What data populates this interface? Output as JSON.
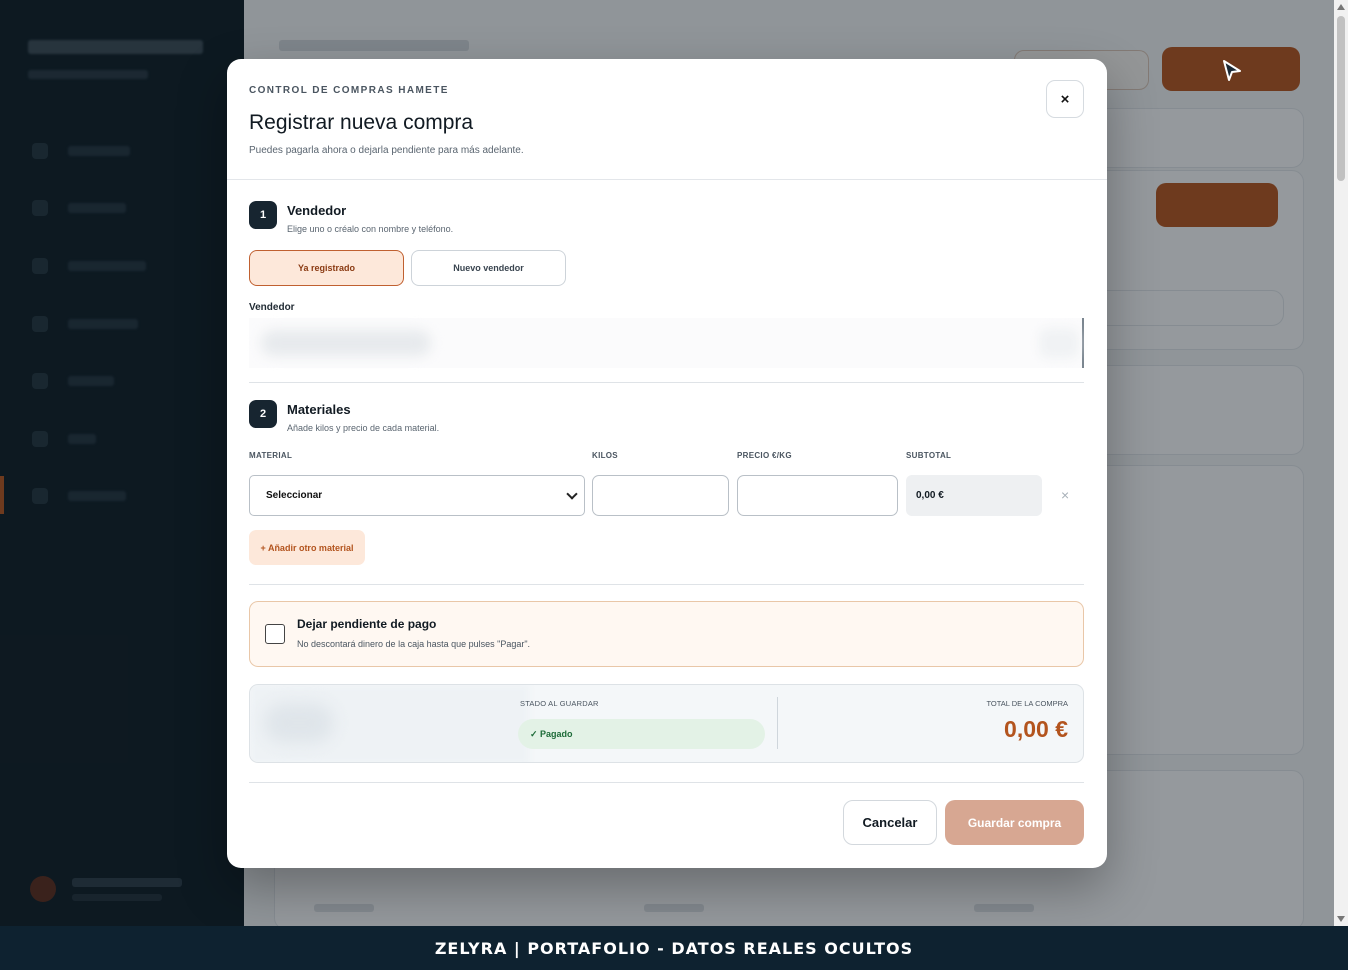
{
  "modal": {
    "eyebrow": "CONTROL DE COMPRAS HAMETE",
    "title": "Registrar nueva compra",
    "description": "Puedes pagarla ahora o dejarla pendiente para más adelante.",
    "close_label": "×"
  },
  "vendor_step": {
    "number": "1",
    "title": "Vendedor",
    "subtitle": "Elige uno o créalo con nombre y teléfono.",
    "option_registered": "Ya registrado",
    "option_new": "Nuevo vendedor",
    "selected_option": "Ya registrado",
    "field_label": "Vendedor"
  },
  "materials_step": {
    "number": "2",
    "title": "Materiales",
    "subtitle": "Añade kilos y precio de cada material.",
    "columns": {
      "material": "MATERIAL",
      "kilos": "KILOS",
      "price": "PRECIO €/KG",
      "subtotal": "SUBTOTAL"
    },
    "row": {
      "material_value": "Seleccionar",
      "kilos_value": "",
      "price_value": "",
      "subtotal_value": "0,00 €",
      "remove_label": "×"
    },
    "add_label": "+ Añadir otro material"
  },
  "pending": {
    "checked": false,
    "title": "Dejar pendiente de pago",
    "note": "No descontará dinero de la caja hasta que pulses \"Pagar\"."
  },
  "summary": {
    "state_label": "STADO AL GUARDAR",
    "state_value": "✓ Pagado",
    "total_label": "TOTAL DE LA COMPRA",
    "total_value": "0,00 €"
  },
  "actions": {
    "cancel": "Cancelar",
    "save": "Guardar compra"
  },
  "footer_banner": "ZELYRA | PORTAFOLIO - DATOS REALES OCULTOS",
  "colors": {
    "accent": "#b3541e",
    "accent_soft": "#fde8da",
    "sidebar": "#0d1b24",
    "success": "#1d6b38",
    "banner": "#0e2230"
  }
}
